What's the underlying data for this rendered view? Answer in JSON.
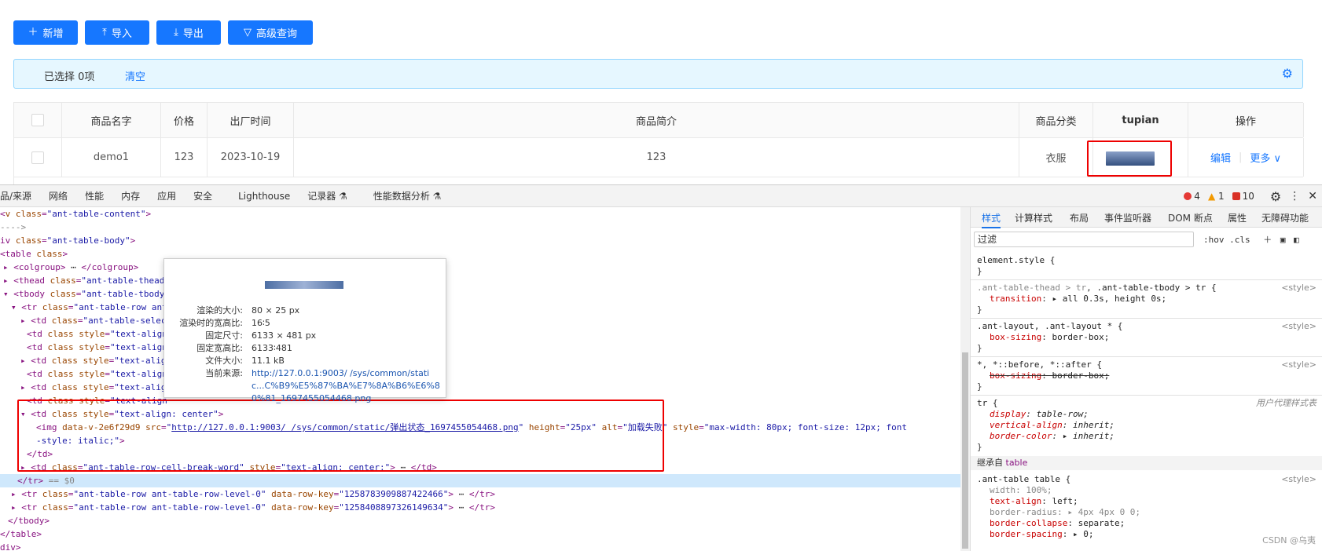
{
  "toolbar": {
    "add": "新增",
    "import": "导入",
    "export": "导出",
    "advanced": "高级查询"
  },
  "alert": {
    "selected": "已选择 0项",
    "clear": "清空"
  },
  "table": {
    "headers": [
      "商品名字",
      "价格",
      "出厂时间",
      "商品简介",
      "商品分类",
      "tupian",
      "操作"
    ],
    "row": {
      "name": "demo1",
      "price": "123",
      "date": "2023-10-19",
      "desc": "123",
      "category": "衣服",
      "edit": "编辑",
      "more": "更多 ∨"
    }
  },
  "devtools": {
    "tabs": [
      "品/来源",
      "网络",
      "性能",
      "内存",
      "应用",
      "安全",
      "Lighthouse",
      "记录器 ⚗",
      "性能数据分析 ⚗"
    ],
    "errors": "4",
    "warnings": "1",
    "issues": "10"
  },
  "tooltip": {
    "rows": [
      {
        "k": "渲染的大小:",
        "v": "80 × 25 px"
      },
      {
        "k": "渲染时的宽高比:",
        "v": "16∶5"
      },
      {
        "k": "固定尺寸:",
        "v": "6133 × 481 px"
      },
      {
        "k": "固定宽高比:",
        "v": "6133∶481"
      },
      {
        "k": "文件大小:",
        "v": "11.1 kB"
      },
      {
        "k": "当前来源:",
        "v": "http://127.0.0.1:9003/          /sys/common/static...C%B9%E5%87%BA%E7%8A%B6%E6%80%81_1697455054468.png"
      }
    ]
  },
  "styles": {
    "tabs": [
      "样式",
      "计算样式",
      "布局",
      "事件监听器",
      "DOM 断点",
      "属性",
      "无障碍功能"
    ],
    "filter": "过滤",
    "tools": ":hov  .cls",
    "inherit_label": "继承自",
    "inherit_tag": "table",
    "source": "<style>",
    "ua": "用户代理样式表"
  },
  "watermark": "CSDN @乌夷"
}
